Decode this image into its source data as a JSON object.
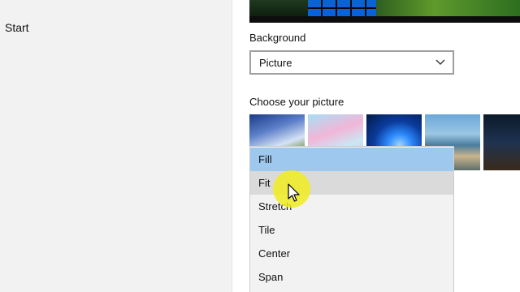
{
  "nav": {
    "start_label": "Start"
  },
  "background": {
    "section_label": "Background",
    "selected_value": "Picture"
  },
  "pictures": {
    "section_label": "Choose your picture"
  },
  "fit_dropdown": {
    "options": [
      {
        "label": "Fill",
        "state": "selected"
      },
      {
        "label": "Fit",
        "state": "hover"
      },
      {
        "label": "Stretch",
        "state": "normal"
      },
      {
        "label": "Tile",
        "state": "normal"
      },
      {
        "label": "Center",
        "state": "normal"
      },
      {
        "label": "Span",
        "state": "normal"
      }
    ]
  },
  "icons": {
    "dropdown": "chevron-down-icon",
    "pointer": "mouse-pointer-icon"
  },
  "colors": {
    "selected_option_bg": "#9fc8ee",
    "hover_option_bg": "#dadada",
    "click_highlight": "#f0ec1e"
  }
}
